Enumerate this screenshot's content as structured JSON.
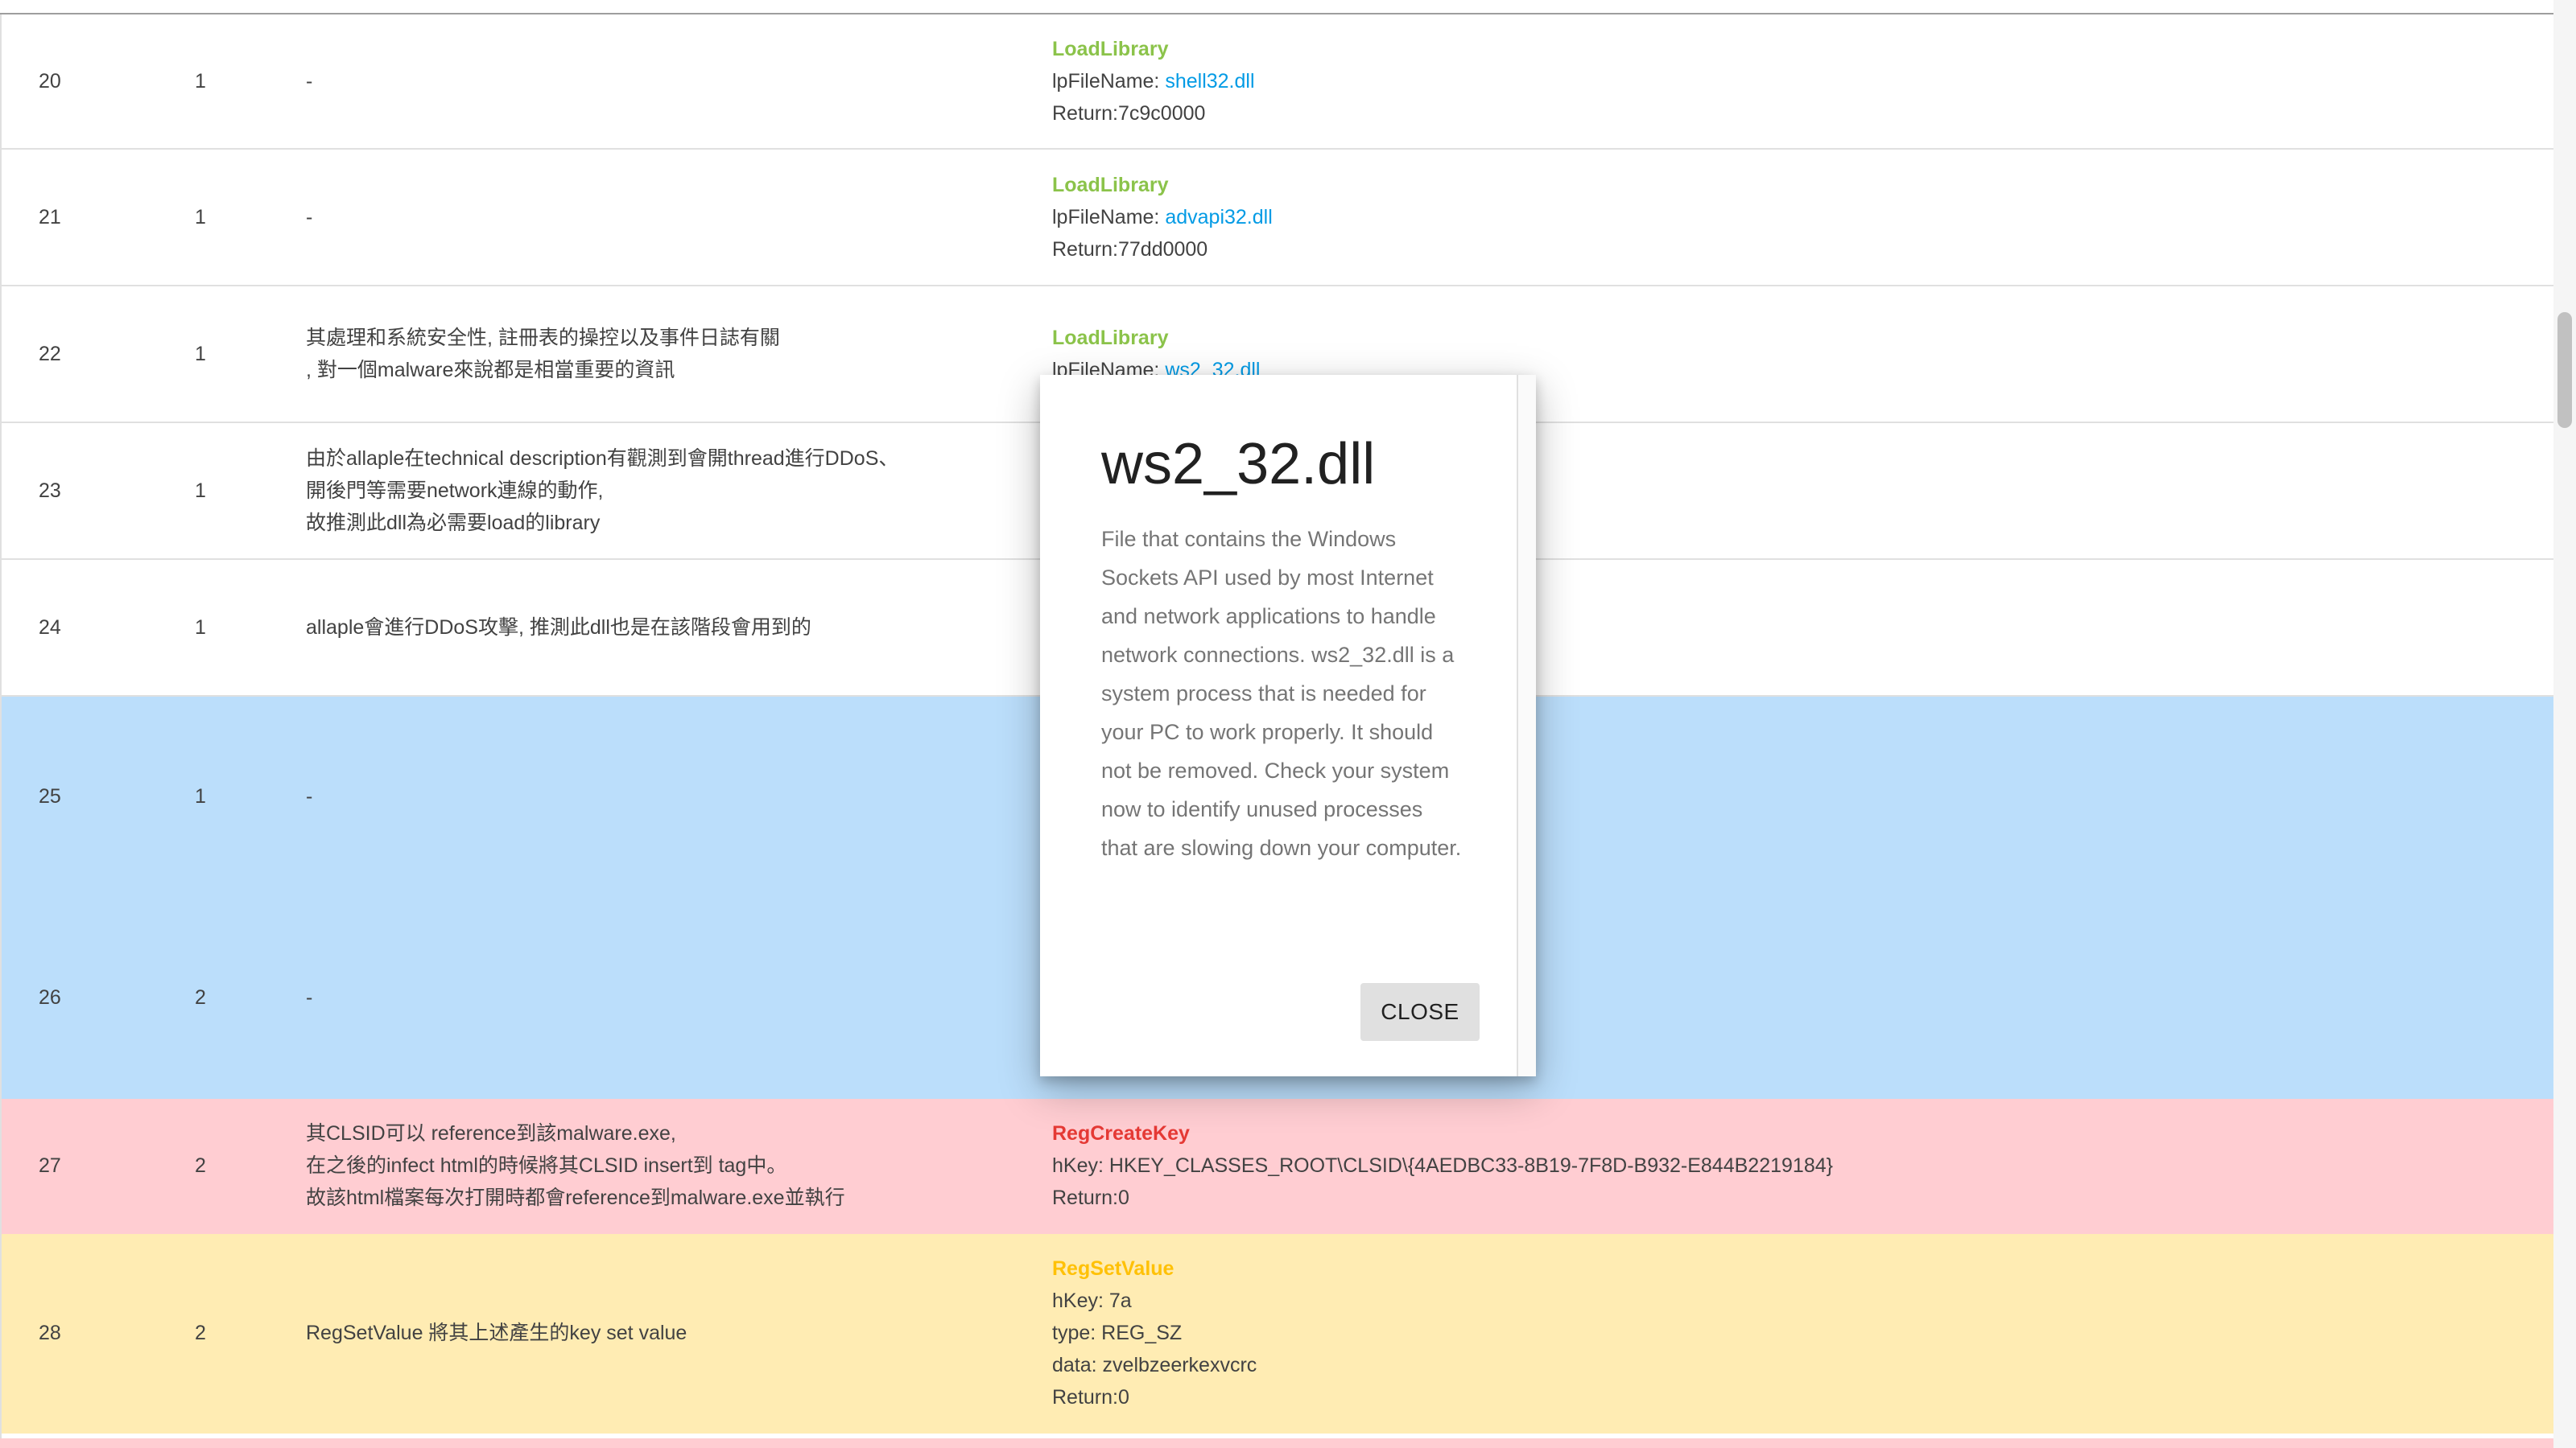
{
  "rows": [
    {
      "no": "20",
      "thread": "1",
      "note": [
        "-"
      ],
      "api": "LoadLibrary",
      "api_color": "green",
      "params": [
        {
          "label": "lpFileName: ",
          "value": "shell32.dll",
          "link": true
        },
        {
          "label": "Return:7c9c0000",
          "value": "",
          "link": false
        }
      ],
      "bg": "normal"
    },
    {
      "no": "21",
      "thread": "1",
      "note": [
        "-"
      ],
      "api": "LoadLibrary",
      "api_color": "green",
      "params": [
        {
          "label": "lpFileName: ",
          "value": "advapi32.dll",
          "link": true
        },
        {
          "label": "Return:77dd0000",
          "value": "",
          "link": false
        }
      ],
      "bg": "normal"
    },
    {
      "no": "22",
      "thread": "1",
      "note": [
        "其處理和系統安全性, 註冊表的操控以及事件日誌有關",
        ", 對一個malware來說都是相當重要的資訊"
      ],
      "api": "LoadLibrary",
      "api_color": "green",
      "params": [
        {
          "label": "lpFileName: ",
          "value": "ws2_32.dll",
          "link": true
        }
      ],
      "bg": "normal"
    },
    {
      "no": "23",
      "thread": "1",
      "note": [
        "由於allaple在technical description有觀測到會開thread進行DDoS、",
        "開後門等需要network連線的動作,",
        "故推測此dll為必需要load的library"
      ],
      "api": "",
      "api_color": "",
      "params": [],
      "bg": "normal"
    },
    {
      "no": "24",
      "thread": "1",
      "note": [
        "allaple會進行DDoS攻擊, 推測此dll也是在該階段會用到的"
      ],
      "api": "",
      "api_color": "",
      "params": [],
      "bg": "normal"
    },
    {
      "no": "25",
      "thread": "1",
      "note": [
        "-"
      ],
      "api": "",
      "api_color": "",
      "params": [],
      "bg": "blue"
    },
    {
      "no": "26",
      "thread": "2",
      "note": [
        "-"
      ],
      "api": "",
      "api_color": "",
      "params": [],
      "bg": "blue"
    },
    {
      "no": "27",
      "thread": "2",
      "note": [
        "其CLSID可以 reference到該malware.exe,",
        "在之後的infect html的時候將其CLSID insert到 tag中。",
        "故該html檔案每次打開時都會reference到malware.exe並執行"
      ],
      "api": "RegCreateKey",
      "api_color": "red",
      "params": [
        {
          "label": "hKey: HKEY_CLASSES_ROOT\\CLSID\\{4AEDBC33-8B19-7F8D-B932-E844B2219184}",
          "value": "",
          "link": false
        },
        {
          "label": "Return:0",
          "value": "",
          "link": false
        }
      ],
      "bg": "pink"
    },
    {
      "no": "28",
      "thread": "2",
      "note": [
        "RegSetValue 將其上述產生的key set value"
      ],
      "api": "RegSetValue",
      "api_color": "amber",
      "params": [
        {
          "label": "hKey: 7a",
          "value": "",
          "link": false
        },
        {
          "label": "type: REG_SZ",
          "value": "",
          "link": false
        },
        {
          "label": "data: zvelbzeerkexvcrc",
          "value": "",
          "link": false
        },
        {
          "label": "Return:0",
          "value": "",
          "link": false
        }
      ],
      "bg": "yellow"
    }
  ],
  "row_heights": {},
  "modal": {
    "title": "ws2_32.dll",
    "body": "File that contains the Windows Sockets API used by most Internet and network applications to handle network connections. ws2_32.dll is a system process that is needed for your PC to work properly. It should not be removed. Check your system now to identify unused processes that are slowing down your computer.",
    "close_label": "CLOSE"
  },
  "colors": {
    "api_green": "#8bc34a",
    "api_red": "#e53935",
    "api_amber": "#ffc107",
    "link": "#039be5",
    "row_blue": "#bbdefb",
    "row_pink": "#ffcdd2",
    "row_yellow": "#ffecb3"
  }
}
